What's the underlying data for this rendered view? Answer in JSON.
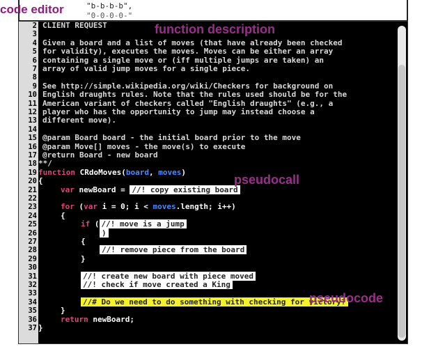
{
  "labels": {
    "code_editor": "code editor",
    "function_description": "function description",
    "pseudocall": "pseudocall",
    "pseudocode": "pseudocode"
  },
  "snippet": {
    "line1": "\"b-b-b-b\",",
    "line2": "\"0-0-0-0-\""
  },
  "editor": {
    "lines": [
      {
        "n": "2",
        "text": "CLIENT REQUEST"
      },
      {
        "n": "3",
        "text": ""
      },
      {
        "n": "4",
        "text": "Given a board and a list of moves (that have already been checked"
      },
      {
        "n": "5",
        "text": "for validity), executes the moves. Moves can be either an array"
      },
      {
        "n": "6",
        "text": "containing a single move or (iff multiple jumps are taken) an"
      },
      {
        "n": "7",
        "text": "array of valid jump moves for a single piece."
      },
      {
        "n": "8",
        "text": ""
      },
      {
        "n": "9",
        "text": "See http://simple.wikipedia.org/wiki/Checkers for background on"
      },
      {
        "n": "10",
        "text": "English draughts rules. Note that the rules used should be for the"
      },
      {
        "n": "11",
        "text": "American variant of checkers called \"English draughts\" (e.g., a"
      },
      {
        "n": "12",
        "text": "player who has the opportunity to jump may instead choose a"
      },
      {
        "n": "13",
        "text": "different move)."
      },
      {
        "n": "14",
        "text": ""
      },
      {
        "n": "15",
        "text": "@param Board board - the initial board prior to the move"
      },
      {
        "n": "16",
        "text": "@param Move[] moves - the move(s) to execute"
      },
      {
        "n": "17",
        "text": "@return Board - new board"
      },
      {
        "n": "18",
        "text": "**/"
      }
    ],
    "code": {
      "l19_kw": "function",
      "l19_fn": "CRdoMoves",
      "l19_open": "(",
      "l19_p1": "board",
      "l19_comma": ", ",
      "l19_p2": "moves",
      "l19_close": ")",
      "l20": "{",
      "l21_kw": "var",
      "l21_var": "newBoard",
      "l21_eq": " = ",
      "l21_hl": "//! copy existing board",
      "l23_kw": "for",
      "l23_a": " (",
      "l23_kw2": "var",
      "l23_b": " i = 0; i < ",
      "l23_p": "moves",
      "l23_c": ".length; i++)",
      "l24": "{",
      "l25_kw": "if",
      "l25_sp": " (",
      "l25_hl": "//! move is a jump",
      "l26": ")",
      "l27": "{",
      "l28_hl": "//! remove piece from the board",
      "l29": "}",
      "l31_hl": "//! create new board with piece moved",
      "l32_hl": "//! check if move created a King",
      "l34_hl": "//# Do we need to do something with checking for victory?",
      "l35": "}",
      "l36_kw": "return",
      "l36_rest": " newBoard;",
      "l37": "}"
    },
    "line_numbers_code": [
      "19",
      "20",
      "21",
      "22",
      "23",
      "24",
      "25",
      "26",
      "27",
      "28",
      "29",
      "30",
      "31",
      "32",
      "33",
      "34",
      "35",
      "36",
      "37"
    ]
  }
}
